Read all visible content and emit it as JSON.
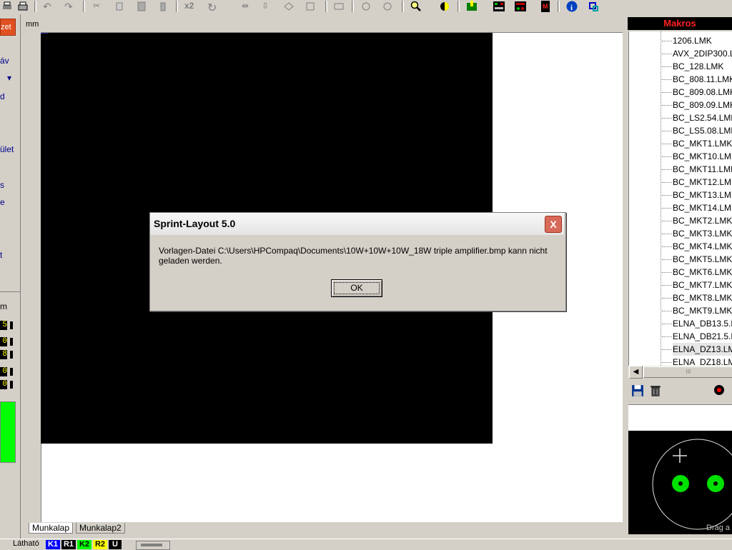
{
  "toolbar": {
    "icons": [
      "print-icon",
      "undo-icon",
      "redo-icon",
      "cut-icon",
      "copy-icon",
      "paste-icon",
      "delete-icon",
      "x2-icon",
      "rotate-icon",
      "mirror-h-icon",
      "mirror-v-icon",
      "group-icon",
      "ungroup-icon",
      "align-icon",
      "zoom-icon",
      "layer-icon",
      "tools-icon",
      "drc-icon",
      "photo-icon",
      "macro-icon",
      "info-icon",
      "move-icon"
    ],
    "x2_label": "x2"
  },
  "left_panel": {
    "tab_label": "zet",
    "items": [
      "áv",
      "d",
      "ület",
      "s",
      "e",
      "t"
    ],
    "unit": "m",
    "numbers": [
      "5",
      "0",
      "8",
      "0",
      "0"
    ],
    "active_color": "#00ff00"
  },
  "workspace": {
    "unit_label": "mm"
  },
  "tabs": [
    "Munkalap",
    "Munkalap2"
  ],
  "statusbar": {
    "label": "Látható",
    "layers": [
      {
        "name": "K1",
        "color": "#0000ff"
      },
      {
        "name": "R1",
        "color": "#000000"
      },
      {
        "name": "K2",
        "color": "#00ff00"
      },
      {
        "name": "R2",
        "color": "#ffff00"
      },
      {
        "name": "U",
        "color": "#000000"
      }
    ]
  },
  "makros": {
    "title": "Makros",
    "items": [
      "1206.LMK",
      "AVX_2DIP300.L",
      "BC_128.LMK",
      "BC_808.11.LMK",
      "BC_809.08.LMK",
      "BC_809.09.LMK",
      "BC_LS2.54.LMK",
      "BC_LS5.08.LMK",
      "BC_MKT1.LMK",
      "BC_MKT10.LMK",
      "BC_MKT11.LMK",
      "BC_MKT12.LMK",
      "BC_MKT13.LMK",
      "BC_MKT14.LMK",
      "BC_MKT2.LMK",
      "BC_MKT3.LMK",
      "BC_MKT4.LMK",
      "BC_MKT5.LMK",
      "BC_MKT6.LMK",
      "BC_MKT7.LMK",
      "BC_MKT8.LMK",
      "BC_MKT9.LMK",
      "ELNA_DB13.5.L",
      "ELNA_DB21.5.L",
      "ELNA_DZ13.LM",
      "ELNA_DZ18.LM"
    ],
    "selected_index": 24,
    "scroll_thumb": "III",
    "preview_text": "Drag a"
  },
  "dialog": {
    "title": "Sprint-Layout 5.0",
    "close_glyph": "X",
    "message": "Vorlagen-Datei C:\\Users\\HPCompaq\\Documents\\10W+10W+10W_18W triple amplifier.bmp kann nicht geladen werden.",
    "ok_label": "OK"
  }
}
